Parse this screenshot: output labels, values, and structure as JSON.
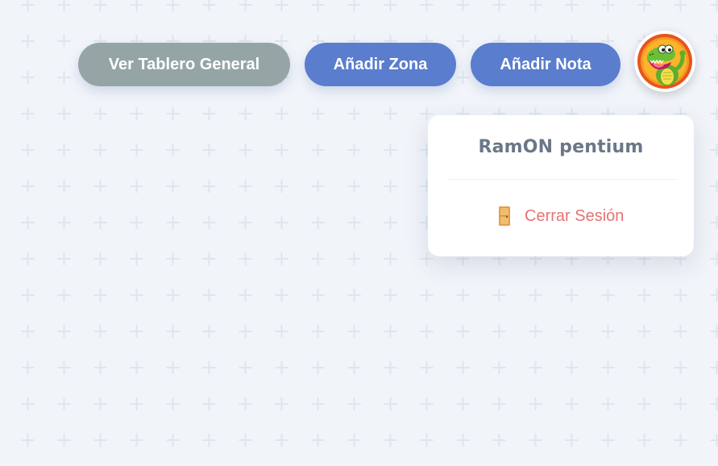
{
  "toolbar": {
    "board_button_label": "Ver Tablero General",
    "add_zone_button_label": "Añadir Zona",
    "add_note_button_label": "Añadir Nota"
  },
  "user_menu": {
    "user_name": "RamON pentium",
    "logout_label": "Cerrar Sesión",
    "logout_icon": "door-icon"
  },
  "avatar": {
    "icon": "crocodile-cartoon-avatar"
  },
  "colors": {
    "background": "#f1f4f9",
    "pattern_plus": "#dfe5ee",
    "board_button": "#95a5a6",
    "primary_button": "#5a7dce",
    "user_name": "#6b7788",
    "logout": "#e57373",
    "avatar_ring": "#e8541c"
  }
}
